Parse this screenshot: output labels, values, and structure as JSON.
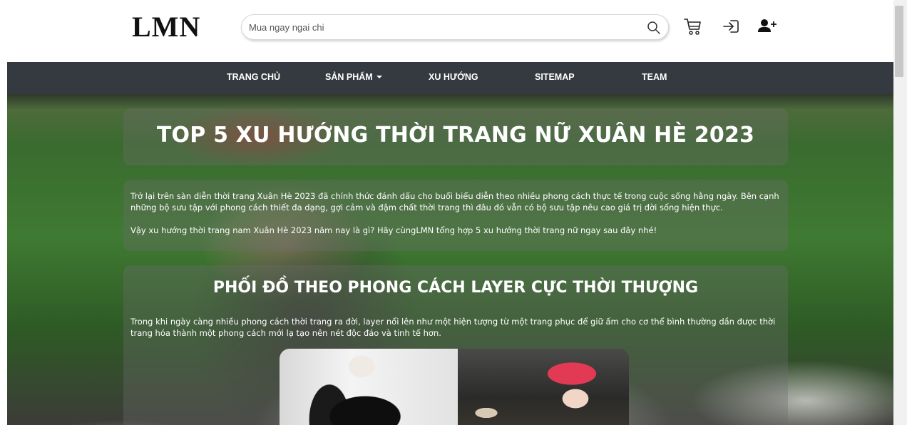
{
  "header": {
    "logo": "LMN",
    "search": {
      "placeholder": "Mua ngay ngai chi",
      "value": ""
    },
    "icons": [
      "search-icon",
      "cart-icon",
      "login-icon",
      "user-plus-icon"
    ]
  },
  "nav": {
    "items": [
      {
        "label": "TRANG CHỦ"
      },
      {
        "label": "SẢN PHẨM",
        "dropdown": true
      },
      {
        "label": "XU HƯỚNG"
      },
      {
        "label": "SITEMAP"
      },
      {
        "label": "TEAM"
      }
    ]
  },
  "article": {
    "title": "TOP 5 XU HƯỚNG THỜI TRANG NỮ XUÂN HÈ 2023",
    "intro": [
      "Trở lại trên sàn diễn thời trang Xuân Hè 2023 đã chính thức đánh dấu cho buổi biểu diễn theo nhiều phong cách thực tế trong cuộc sống hằng ngày. Bên cạnh những bộ sưu tập với phong cách thiết đa dạng, gợi cảm và đậm chất thời trang thì đâu đó vẫn có bộ sưu tập nêu cao giá trị đời sống hiện thực.",
      "Vậy xu hướng thời trang nam Xuân Hè 2023 năm nay là gì? Hãy cùngLMN tổng hợp 5 xu hướng thời trang nữ ngay sau đây nhé!"
    ],
    "section": {
      "heading": "PHỐI ĐỒ THEO PHONG CÁCH LAYER CỰC THỜI THƯỢNG",
      "text": "Trong khi ngày càng nhiều phong cách thời trang ra đời, layer nổi lên như một hiện tượng từ một trang phục để giữ ấm cho cơ thể bình thường dần được thời trang hóa thành một phong cách mới lạ tạo nên nét độc đáo và tinh tế hơn."
    }
  },
  "colors": {
    "nav_bg": "#343a40",
    "text_light": "#ffffff",
    "panel_overlay": "rgba(110,110,110,0.35)"
  }
}
